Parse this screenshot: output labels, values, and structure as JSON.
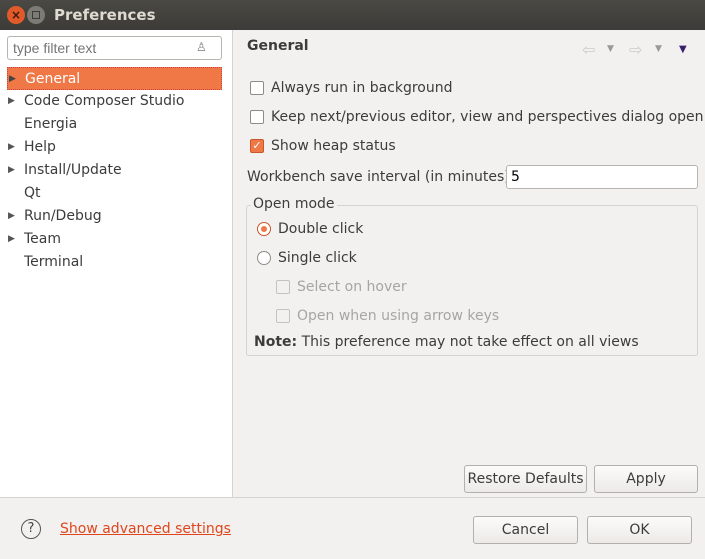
{
  "window": {
    "title": "Preferences"
  },
  "filter": {
    "placeholder": "type filter text"
  },
  "tree": [
    {
      "label": "General",
      "expandable": true,
      "selected": true
    },
    {
      "label": "Code Composer Studio",
      "expandable": true
    },
    {
      "label": "Energia",
      "expandable": false
    },
    {
      "label": "Help",
      "expandable": true
    },
    {
      "label": "Install/Update",
      "expandable": true
    },
    {
      "label": "Qt",
      "expandable": false
    },
    {
      "label": "Run/Debug",
      "expandable": true
    },
    {
      "label": "Team",
      "expandable": true
    },
    {
      "label": "Terminal",
      "expandable": false
    }
  ],
  "page": {
    "title": "General",
    "always_run_bg": "Always run in background",
    "keep_dialog": "Keep next/previous editor, view and perspectives dialog open",
    "show_heap": "Show heap status",
    "save_interval_label": "Workbench save interval (in minutes):",
    "save_interval_value": "5",
    "open_mode": {
      "legend": "Open mode",
      "double": "Double click",
      "single": "Single click",
      "hover": "Select on hover",
      "arrow": "Open when using arrow keys",
      "note_bold": "Note:",
      "note": "This preference may not take effect on all views"
    },
    "restore": "Restore Defaults",
    "apply": "Apply"
  },
  "footer": {
    "advanced": "Show advanced settings",
    "cancel": "Cancel",
    "ok": "OK",
    "help_icon": "?"
  },
  "colors": {
    "accent": "#f07746",
    "link": "#e0461d"
  }
}
